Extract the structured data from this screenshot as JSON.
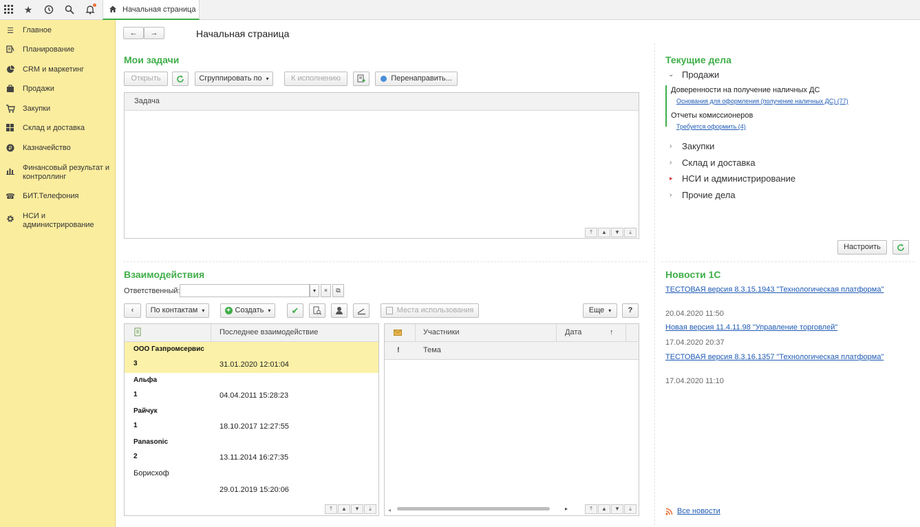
{
  "topbar": {
    "icons": [
      "apps-grid-icon",
      "star-icon",
      "history-icon",
      "search-icon",
      "bell-icon"
    ],
    "tab_label": "Начальная страница"
  },
  "sidebar": {
    "items": [
      {
        "icon": "menu-icon",
        "label": "Главное"
      },
      {
        "icon": "planning-icon",
        "label": "Планирование"
      },
      {
        "icon": "pie-chart-icon",
        "label": "CRM и маркетинг"
      },
      {
        "icon": "briefcase-icon",
        "label": "Продажи"
      },
      {
        "icon": "cart-icon",
        "label": "Закупки"
      },
      {
        "icon": "warehouse-icon",
        "label": "Склад и доставка"
      },
      {
        "icon": "coin-icon",
        "label": "Казначейство"
      },
      {
        "icon": "bar-chart-icon",
        "label": "Финансовый результат и контроллинг"
      },
      {
        "icon": "phone-icon",
        "label": "БИТ.Телефония"
      },
      {
        "icon": "gear-icon",
        "label": "НСИ и администрирование"
      }
    ]
  },
  "header": {
    "title": "Начальная страница"
  },
  "my_tasks": {
    "title": "Мои задачи",
    "buttons": {
      "open": "Открыть",
      "group_by": "Сгруппировать по",
      "to_execute": "К исполнению",
      "redirect": "Перенаправить..."
    },
    "column": "Задача"
  },
  "current_affairs": {
    "title": "Текущие дела",
    "sales": {
      "label": "Продажи",
      "groups": [
        {
          "title": "Доверенности на получение наличных ДС",
          "link": "Основания для оформления (получение наличных ДС) (77)"
        },
        {
          "title": "Отчеты комиссионеров",
          "link": "Требуется оформить (4)"
        }
      ]
    },
    "items": [
      "Закупки",
      "Склад и доставка",
      "НСИ и администрирование",
      "Прочие дела"
    ],
    "configure": "Настроить"
  },
  "interactions": {
    "title": "Взаимодействия",
    "responsible_label": "Ответственный:",
    "responsible_value": "",
    "buttons": {
      "by_contacts": "По контактам",
      "create": "Создать",
      "usage_places": "Места использования",
      "more": "Еще",
      "help": "?"
    },
    "left_columns": [
      "Последнее взаимодействие"
    ],
    "rows": [
      {
        "name": "ООО Газпромсервис",
        "count": "3",
        "date": "31.01.2020 12:01:04"
      },
      {
        "name": "Альфа",
        "count": "1",
        "date": "04.04.2011 15:28:23"
      },
      {
        "name": "Райчук",
        "count": "1",
        "date": "18.10.2017 12:27:55"
      },
      {
        "name": "Panasonic",
        "count": "2",
        "date": "13.11.2014 16:27:35"
      },
      {
        "name": "Борисхоф",
        "count": "",
        "date": "29.01.2019 15:20:06"
      }
    ],
    "right_columns": {
      "participants": "Участники",
      "date": "Дата",
      "subject": "Тема",
      "importance": "!"
    }
  },
  "news": {
    "title": "Новости 1С",
    "items": [
      {
        "link": "ТЕСТОВАЯ версия 8.3.15.1943 \"Технологическая платформа\"",
        "date": "20.04.2020 11:50"
      },
      {
        "link": "Новая версия 11.4.11.98 \"Управление торговлей\"",
        "date": "17.04.2020 20:37"
      },
      {
        "link": "ТЕСТОВАЯ версия 8.3.16.1357 \"Технологическая платформа\"",
        "date": "17.04.2020 11:10"
      }
    ],
    "all_news": "Все новости"
  },
  "colors": {
    "accent_green": "#3fae49",
    "sidebar_bg": "#fbed9e",
    "selected_row": "#fbf1a8",
    "link": "#1f5bb5"
  }
}
